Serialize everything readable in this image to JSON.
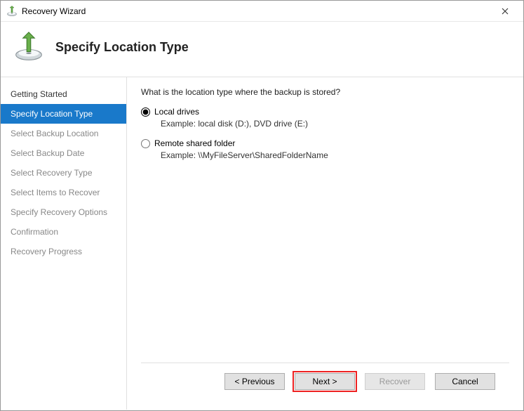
{
  "window": {
    "title": "Recovery Wizard"
  },
  "header": {
    "title": "Specify Location Type"
  },
  "sidebar": {
    "steps": [
      "Getting Started",
      "Specify Location Type",
      "Select Backup Location",
      "Select Backup Date",
      "Select Recovery Type",
      "Select Items to Recover",
      "Specify Recovery Options",
      "Confirmation",
      "Recovery Progress"
    ]
  },
  "content": {
    "question": "What is the location type where the backup is stored?",
    "options": [
      {
        "label": "Local drives",
        "example": "Example: local disk (D:), DVD drive (E:)",
        "selected": true
      },
      {
        "label": "Remote shared folder",
        "example": "Example: \\\\MyFileServer\\SharedFolderName",
        "selected": false
      }
    ]
  },
  "footer": {
    "previous": "< Previous",
    "next": "Next >",
    "recover": "Recover",
    "cancel": "Cancel"
  }
}
